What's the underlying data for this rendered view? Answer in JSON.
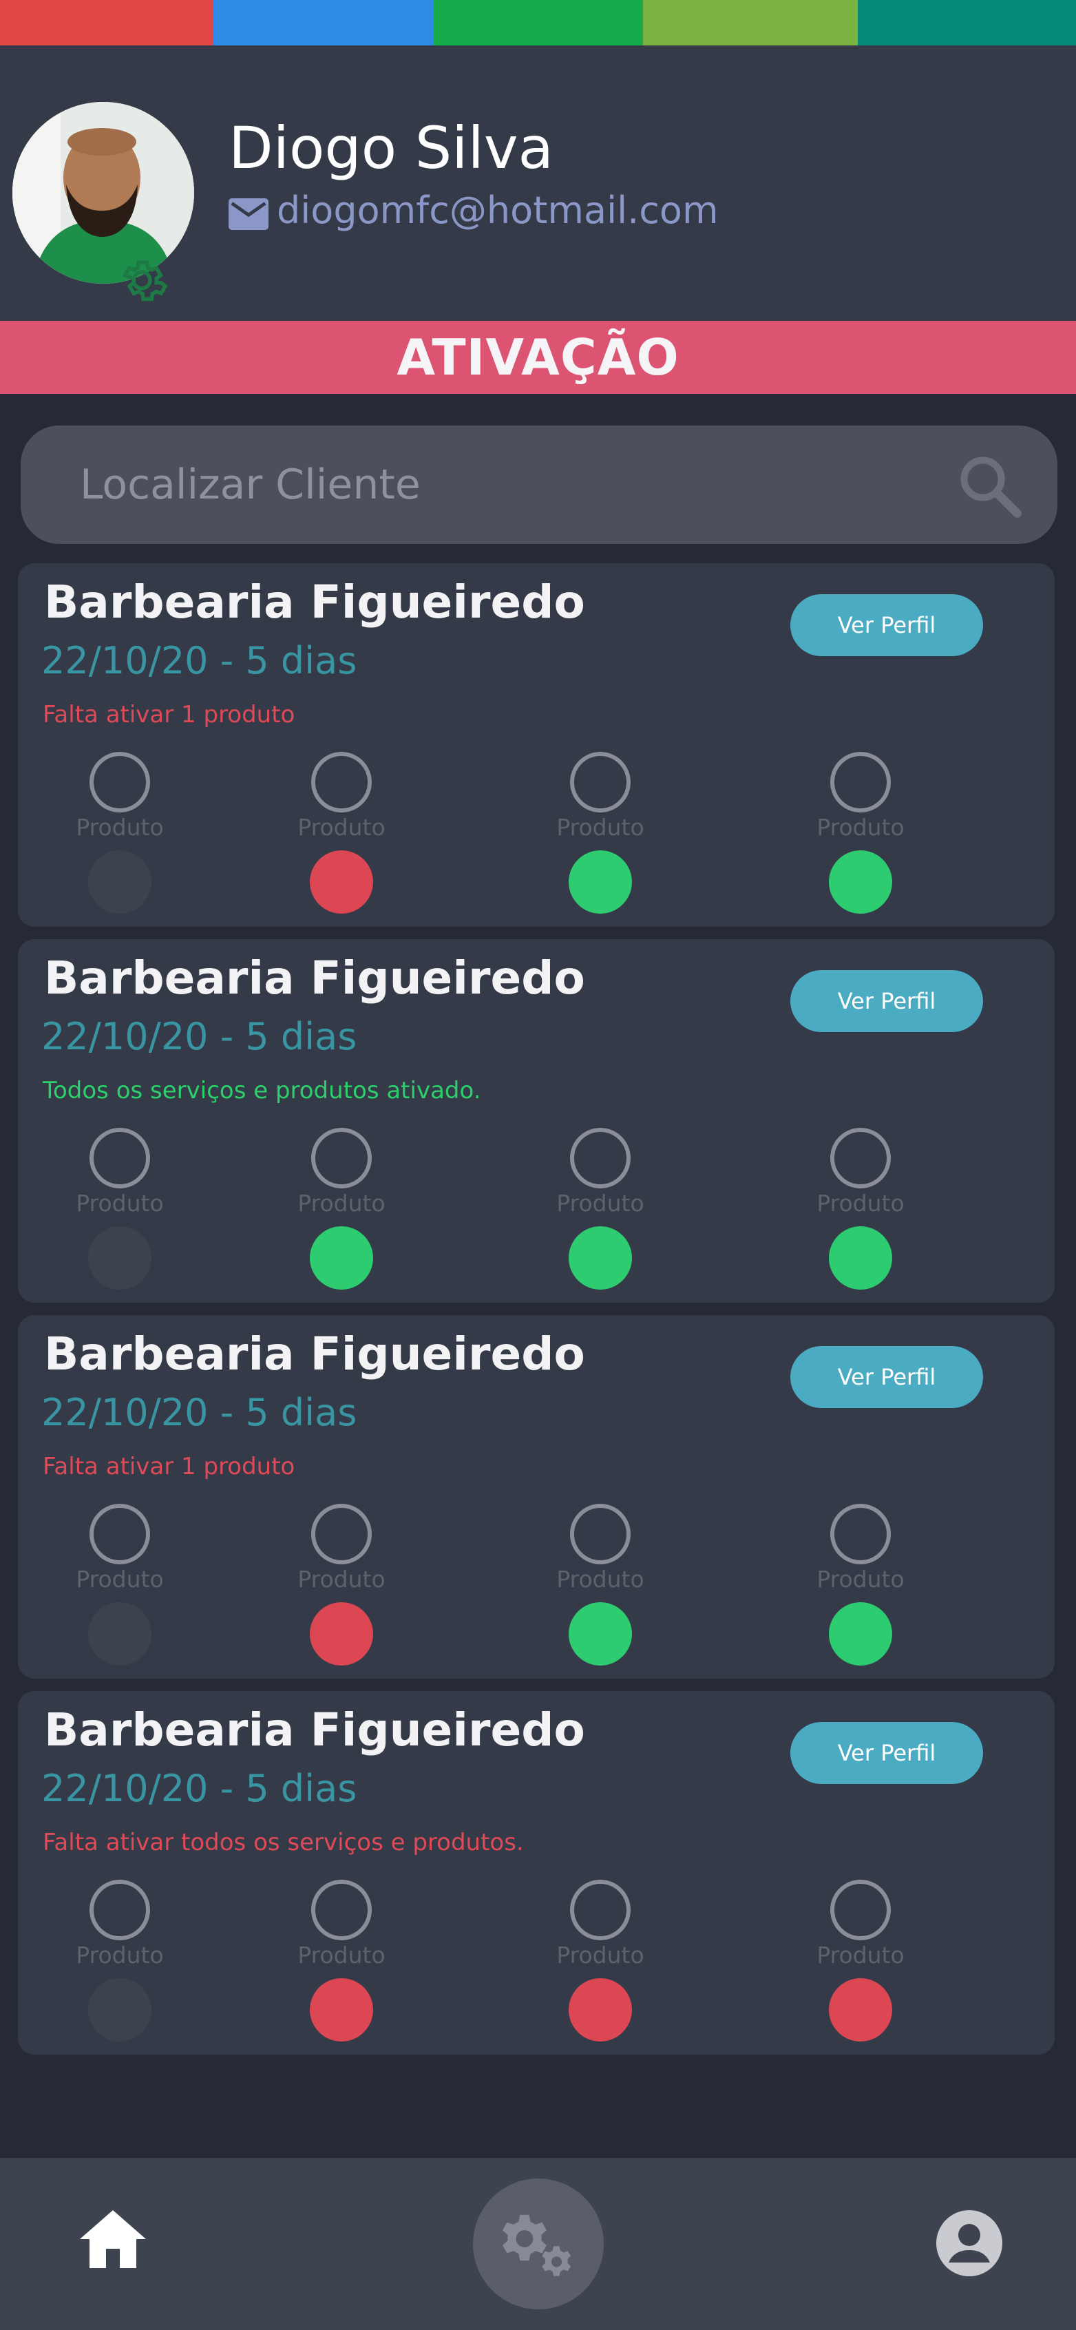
{
  "header": {
    "user_name": "Diogo Silva",
    "user_email": "diogomfc@hotmail.com",
    "strip_colors": [
      "#e04848",
      "#2f8be6",
      "#16ac4d",
      "#7bb342",
      "#078a7a"
    ]
  },
  "section": {
    "title": "ATIVAÇÃO"
  },
  "search": {
    "placeholder": "Localizar Cliente",
    "value": ""
  },
  "colors": {
    "active": "#2ecc71",
    "inactive": "#dc4753",
    "disabled": "#3d424f",
    "accent": "#4aabc2",
    "banner": "#dd5473"
  },
  "clients": [
    {
      "name": "Barbearia Figueiredo",
      "date": "22/10/20 - 5 dias",
      "status": "Falta ativar 1 produto",
      "status_type": "warn",
      "profile_label": "Ver Perfil",
      "products": [
        {
          "label": "Produto",
          "state": "disabled"
        },
        {
          "label": "Produto",
          "state": "inactive"
        },
        {
          "label": "Produto",
          "state": "active"
        },
        {
          "label": "Produto",
          "state": "active"
        }
      ]
    },
    {
      "name": "Barbearia Figueiredo",
      "date": "22/10/20 - 5 dias",
      "status": "Todos os serviços e produtos ativado.",
      "status_type": "ok",
      "profile_label": "Ver Perfil",
      "products": [
        {
          "label": "Produto",
          "state": "disabled"
        },
        {
          "label": "Produto",
          "state": "active"
        },
        {
          "label": "Produto",
          "state": "active"
        },
        {
          "label": "Produto",
          "state": "active"
        }
      ]
    },
    {
      "name": "Barbearia Figueiredo",
      "date": "22/10/20 - 5 dias",
      "status": "Falta ativar 1 produto",
      "status_type": "warn",
      "profile_label": "Ver Perfil",
      "products": [
        {
          "label": "Produto",
          "state": "disabled"
        },
        {
          "label": "Produto",
          "state": "inactive"
        },
        {
          "label": "Produto",
          "state": "active"
        },
        {
          "label": "Produto",
          "state": "active"
        }
      ]
    },
    {
      "name": "Barbearia Figueiredo",
      "date": "22/10/20 - 5 dias",
      "status": "Falta ativar todos os serviços e produtos.",
      "status_type": "warn",
      "profile_label": "Ver Perfil",
      "products": [
        {
          "label": "Produto",
          "state": "disabled"
        },
        {
          "label": "Produto",
          "state": "inactive"
        },
        {
          "label": "Produto",
          "state": "inactive"
        },
        {
          "label": "Produto",
          "state": "inactive"
        }
      ]
    }
  ],
  "bottom_nav": {
    "items": [
      {
        "icon": "home-icon"
      },
      {
        "icon": "gears-icon"
      },
      {
        "icon": "account-circle-icon"
      }
    ]
  }
}
